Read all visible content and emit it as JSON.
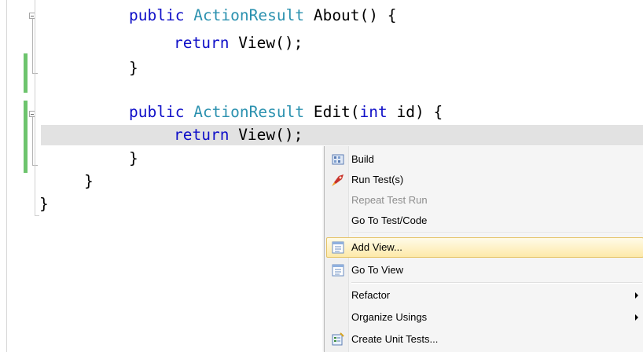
{
  "code": {
    "line1": {
      "kw": "public",
      "type": "ActionResult",
      "rest": " About() {"
    },
    "line2": {
      "kw": "return",
      "rest": " View();"
    },
    "line3": {
      "rest": "}"
    },
    "line5": {
      "kw": "public",
      "type": "ActionResult",
      "rest_a": " Edit(",
      "kw2": "int",
      "rest_b": " id) {"
    },
    "line6": {
      "kw": "return",
      "rest": " View();"
    },
    "line7": {
      "rest": "}"
    },
    "line8": {
      "rest": "}"
    },
    "line9": {
      "rest": "}"
    }
  },
  "context_menu": {
    "items": [
      {
        "label": "Build",
        "icon": "build-icon",
        "enabled": true
      },
      {
        "label": "Run Test(s)",
        "icon": "rocket-icon",
        "enabled": true
      },
      {
        "label": "Repeat Test Run",
        "icon": "",
        "enabled": false
      },
      {
        "label": "Go To Test/Code",
        "icon": "",
        "enabled": true
      },
      {
        "label": "Add View...",
        "icon": "add-view-icon",
        "enabled": true,
        "hovered": true
      },
      {
        "label": "Go To View",
        "icon": "go-to-view-icon",
        "enabled": true
      },
      {
        "label": "Refactor",
        "icon": "",
        "enabled": true,
        "submenu": true
      },
      {
        "label": "Organize Usings",
        "icon": "",
        "enabled": true,
        "submenu": true
      },
      {
        "label": "Create Unit Tests...",
        "icon": "unit-test-icon",
        "enabled": true
      }
    ]
  },
  "colors": {
    "keyword": "#1010c8",
    "type": "#2b91af",
    "change_bar": "#6dc46d",
    "current_line": "#e2e2e2",
    "menu_hover": "#fde9a9"
  }
}
